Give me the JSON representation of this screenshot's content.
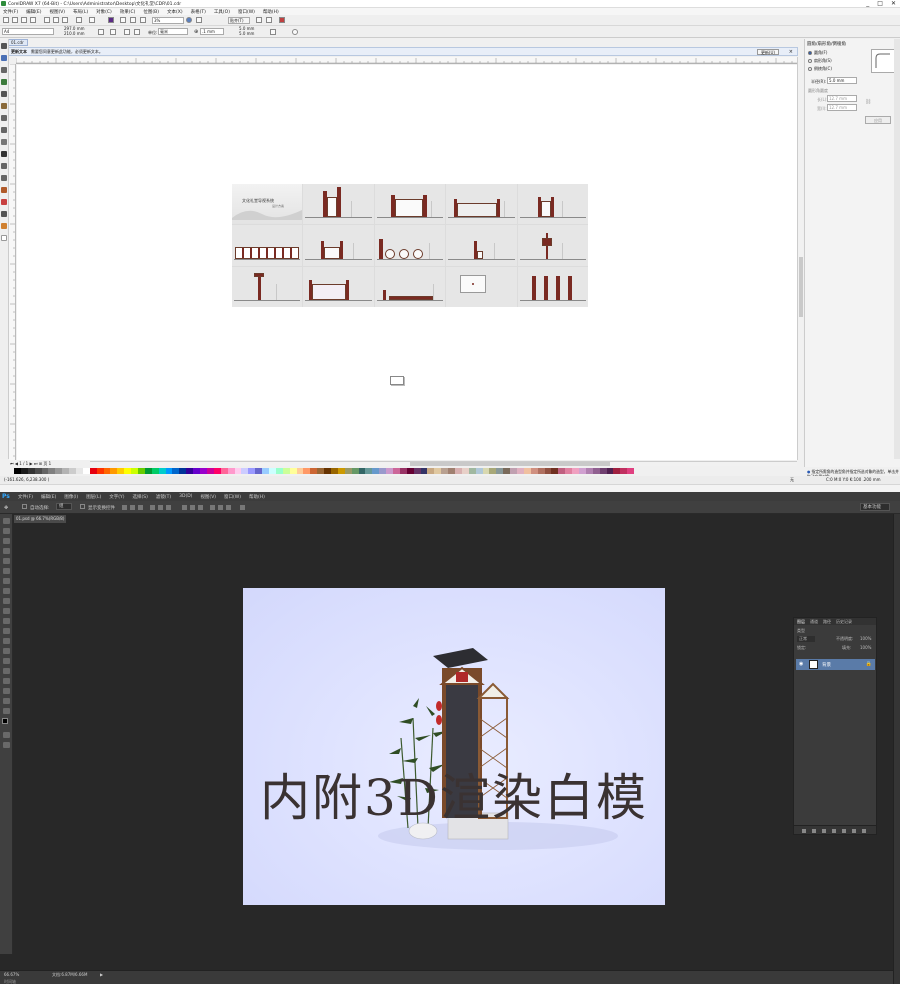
{
  "cdr": {
    "title": "CorelDRAW X7 (64-Bit) - C:\\Users\\Administrator\\Desktop\\文化礼堂\\CDR\\01.cdr",
    "win_buttons": [
      "_",
      "□",
      "✕"
    ],
    "menu": [
      "文件(F)",
      "编辑(E)",
      "视图(V)",
      "布局(L)",
      "对象(C)",
      "效果(C)",
      "位图(B)",
      "文本(X)",
      "表格(T)",
      "工具(O)",
      "窗口(W)",
      "帮助(H)"
    ],
    "std_toolbar": {
      "zoom": "3%",
      "snap": "贴齐(T)"
    },
    "property_bar": {
      "page_size": "A4",
      "width": "297.0 mm",
      "height": "210.0 mm",
      "units_label": "单位:",
      "units": "毫米",
      "nudge": ".1 mm",
      "dup_x": "5.0 mm",
      "dup_y": "5.0 mm"
    },
    "doc_tab": "01.cdr",
    "info_bar": {
      "title": "更新文本",
      "message": "需要您同意更新此功能，必须更新文本。",
      "button": "更新(U)",
      "close": "×"
    },
    "page_nav": {
      "current": "1 / 1",
      "page_label": "页 1"
    },
    "docker": {
      "header": "圆角/扇形角/倒棱角",
      "options": [
        "圆角(F)",
        "扇形角(S)",
        "倒棱角(C)"
      ],
      "radius_label": "半径(R):",
      "radius_value": "5.0 mm",
      "section": "圆形角圆度",
      "field1_label": "长(L):",
      "field1_value": "12.7 mm",
      "field2_label": "宽(I):",
      "field2_value": "12.7 mm",
      "apply": "应用",
      "tip": "指定所需角的造型角并指定所选对象的造型，单击并拖动应用对象。"
    },
    "drawing": {
      "thumb1_title": "文化礼堂导视系统",
      "thumb1_sub": "设计方案"
    },
    "palette": [
      "#000000",
      "#1a1a1a",
      "#333333",
      "#4d4d4d",
      "#666666",
      "#808080",
      "#999999",
      "#b3b3b3",
      "#cccccc",
      "#e6e6e6",
      "#ffffff",
      "#e6000f",
      "#ff3300",
      "#ff6600",
      "#ff9900",
      "#ffcc00",
      "#ffff00",
      "#ccff00",
      "#66cc00",
      "#009933",
      "#00cc66",
      "#00cccc",
      "#0099ff",
      "#0066cc",
      "#003399",
      "#330099",
      "#6600cc",
      "#9900cc",
      "#cc0099",
      "#ff0066",
      "#ff6699",
      "#ff99cc",
      "#ffccee",
      "#ccccff",
      "#9999ff",
      "#6666cc",
      "#99ccff",
      "#ccffff",
      "#99ffcc",
      "#ccff99",
      "#ffff99",
      "#ffcc99",
      "#ff9966",
      "#cc6633",
      "#996633",
      "#663300",
      "#996600",
      "#cc9900",
      "#999966",
      "#669966",
      "#336666",
      "#669999",
      "#6699cc",
      "#9999cc",
      "#cc99cc",
      "#cc6699",
      "#993366",
      "#660033",
      "#663366",
      "#333366",
      "#c8a882",
      "#e0c8a0",
      "#b8a090",
      "#a08070",
      "#d8b0b0",
      "#e8d0c8",
      "#a0b8a0",
      "#b0c8d8",
      "#d8d8b0",
      "#a8a878",
      "#889898",
      "#7a6a5a",
      "#c0a0b0",
      "#e0b0c0",
      "#f0c0a0",
      "#d09080",
      "#b07060",
      "#905040",
      "#703020",
      "#c06080",
      "#e080a0",
      "#f0a0c0",
      "#d0a0d0",
      "#b080b0",
      "#906090",
      "#704070",
      "#502050",
      "#a02040",
      "#c03060",
      "#e04080"
    ],
    "status": {
      "coords": "(-161.626, 6,238.300 )",
      "fill_info": "C:0 M:0 Y:0 K:100  .200 mm",
      "none": "无"
    }
  },
  "ps": {
    "logo": "Ps",
    "menu": [
      "文件(F)",
      "编辑(E)",
      "图像(I)",
      "图层(L)",
      "文字(Y)",
      "选择(S)",
      "滤镜(T)",
      "3D(D)",
      "视图(V)",
      "窗口(W)",
      "帮助(H)"
    ],
    "options": {
      "auto_select": "自动选择:",
      "auto_select_value": "组",
      "show_transform": "显示变换控件",
      "workspace": "基本功能"
    },
    "doc_tab": "01.psd @ 66.7%(RGB/8)",
    "image_overlay": "内附3D渲染白模",
    "layers_panel": {
      "tabs": [
        "图层",
        "通道",
        "路径",
        "历史记录"
      ],
      "kind_label": "类型",
      "mode": "正常",
      "opacity_label": "不透明度:",
      "opacity": "100%",
      "lock_label": "锁定:",
      "fill_label": "填充:",
      "fill": "100%",
      "layer_name": "背景"
    },
    "status": {
      "zoom": "66.67%",
      "doc": "文档:6.87M/6.66M",
      "timeline": "时间轴"
    }
  }
}
